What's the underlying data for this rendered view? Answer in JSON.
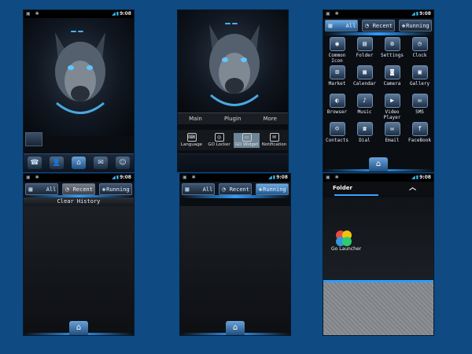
{
  "status": {
    "time": "9:08"
  },
  "screens": [
    {
      "id": "home",
      "dock": [
        "☎",
        "👤",
        "⌂",
        "✉",
        "☺"
      ]
    },
    {
      "id": "menu",
      "menu_tabs": [
        "Main",
        "Plugin",
        "More"
      ],
      "menu_items": [
        {
          "label": "Language",
          "icon": "language-icon"
        },
        {
          "label": "GO Locker",
          "icon": "lock-icon"
        },
        {
          "label": "GO Widget",
          "icon": "widget-icon",
          "selected": true
        },
        {
          "label": "Notification",
          "icon": "notification-icon"
        }
      ]
    },
    {
      "id": "all-apps",
      "tabs": [
        "All",
        "Recent",
        "Running"
      ],
      "apps": [
        {
          "label": "Common Icon",
          "icon": "common-icon"
        },
        {
          "label": "Folder",
          "icon": "folder-icon"
        },
        {
          "label": "Settings",
          "icon": "settings-icon"
        },
        {
          "label": "Clock",
          "icon": "clock-icon"
        },
        {
          "label": "Market",
          "icon": "market-icon"
        },
        {
          "label": "Calendar",
          "icon": "calendar-icon"
        },
        {
          "label": "Camera",
          "icon": "camera-icon"
        },
        {
          "label": "Gallery",
          "icon": "gallery-icon"
        },
        {
          "label": "Browser",
          "icon": "browser-icon"
        },
        {
          "label": "Music",
          "icon": "music-icon"
        },
        {
          "label": "Video Player",
          "icon": "video-icon"
        },
        {
          "label": "SMS",
          "icon": "sms-icon"
        },
        {
          "label": "Contacts",
          "icon": "contacts-icon"
        },
        {
          "label": "Dial",
          "icon": "dial-icon"
        },
        {
          "label": "Email",
          "icon": "email-icon"
        },
        {
          "label": "FaceBook",
          "icon": "facebook-icon"
        }
      ]
    },
    {
      "id": "recent",
      "clear_label": "Clear History"
    },
    {
      "id": "running"
    },
    {
      "id": "folder",
      "folder_title": "Folder",
      "folder_app": "Go Launcher"
    }
  ]
}
